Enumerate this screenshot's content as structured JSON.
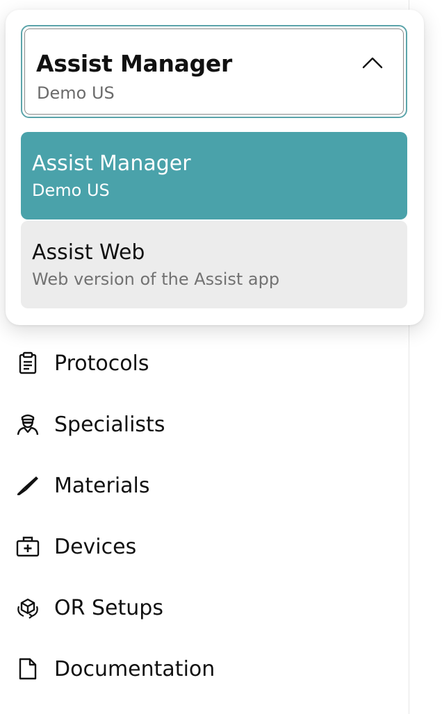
{
  "dropdown": {
    "selected": {
      "title": "Assist Manager",
      "subtitle": "Demo US"
    },
    "options": [
      {
        "title": "Assist Manager",
        "subtitle": "Demo US",
        "selected": true
      },
      {
        "title": "Assist Web",
        "subtitle": "Web version of the Assist app",
        "selected": false
      }
    ],
    "chevron_icon": "chevron-up-icon",
    "accent_color": "#4aa2aa"
  },
  "nav": {
    "items": [
      {
        "label": "Protocols",
        "icon": "clipboard-icon"
      },
      {
        "label": "Specialists",
        "icon": "specialist-icon"
      },
      {
        "label": "Materials",
        "icon": "scalpel-icon"
      },
      {
        "label": "Devices",
        "icon": "medical-case-icon"
      },
      {
        "label": "OR Setups",
        "icon": "cube-rotate-icon"
      },
      {
        "label": "Documentation",
        "icon": "document-icon"
      }
    ]
  }
}
